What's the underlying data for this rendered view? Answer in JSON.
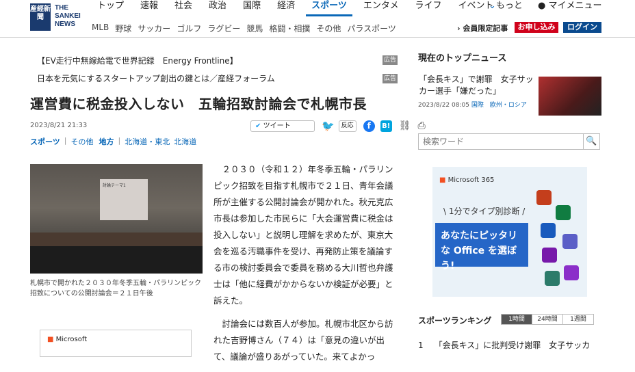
{
  "header": {
    "logo": "産經新聞",
    "logo_text": "THE SANKEI NEWS",
    "nav": [
      "トップ",
      "速報",
      "社会",
      "政治",
      "国際",
      "経済",
      "スポーツ",
      "エンタメ",
      "ライフ",
      "イベント"
    ],
    "nav_active": "スポーツ",
    "more": "もっと",
    "mymenu": "マイメニュー",
    "subnav": [
      "MLB",
      "野球",
      "サッカー",
      "ゴルフ",
      "ラグビー",
      "競馬",
      "格闘・相撲",
      "その他",
      "パラスポーツ"
    ],
    "member_articles": "会員限定記事",
    "subscribe": "お申し込み",
    "login": "ログイン"
  },
  "ads_text": [
    {
      "text": "【EV走行中無線給電で世界記録　Energy Frontline】",
      "tag": "広告"
    },
    {
      "text": "日本を元気にするスタートアップ創出の鍵とは／産経フォーラム",
      "tag": "広告"
    }
  ],
  "article": {
    "title": "運営費に税金投入しない　五輪招致討論会で札幌市長",
    "date": "2023/8/21 21:33",
    "tweet_label": "ツイート",
    "hannou": "反応",
    "hatena": "B!",
    "categories": [
      [
        "スポーツ",
        "その他"
      ],
      [
        "地方",
        "北海道・東北",
        "北海道"
      ]
    ],
    "photo_screen": "討論テーマ1",
    "caption": "札幌市で開かれた２０３０年冬季五輪・パラリンピック招致についての公開討論会＝２１日午後",
    "paragraphs": [
      "２０３０（令和１２）年冬季五輪・パラリンピック招致を目指す札幌市で２１日、青年会議所が主催する公開討論会が開かれた。秋元克広市長は参加した市民らに「大会運営費に税金は投入しない」と説明し理解を求めたが、東京大会を巡る汚職事件を受け、再発防止策を議論する市の検討委員会で委員を務める大川哲也弁護士は「他に経費がかからないか検証が必要」と訴えた。",
      "討論会には数百人が参加。札幌市北区から訪れた吉野博さん（７４）は「意見の違いが出て、議論が盛りあがっていた。来てよかっ"
    ],
    "ad_brand": "Microsoft"
  },
  "sidebar": {
    "top_news_heading": "現在のトップニュース",
    "top_news_title": "「会長キス」で謝罪　女子サッカー選手「嫌だった」",
    "top_news_meta": "2023/8/22 08:05",
    "top_news_cats": "国際　欧州・ロシア",
    "search_placeholder": "検索ワード",
    "ms_ad": {
      "brand": "Microsoft 365",
      "tag": "\\ 1分でタイプ別診断 /",
      "cta": "あなたにピッタリな Office を選ぼう!"
    },
    "ranking_heading": "スポーツランキング",
    "ranking_tabs": [
      "1時間",
      "24時間",
      "1週間"
    ],
    "ranking_items": [
      {
        "rank": "1",
        "title": "「会長キス」に批判受け謝罪　女子サッカ"
      }
    ]
  },
  "colors": {
    "brand": "#1a3a6e",
    "accent": "#0a68b8",
    "subscribe": "#d0021b",
    "login": "#0a4a8e"
  }
}
